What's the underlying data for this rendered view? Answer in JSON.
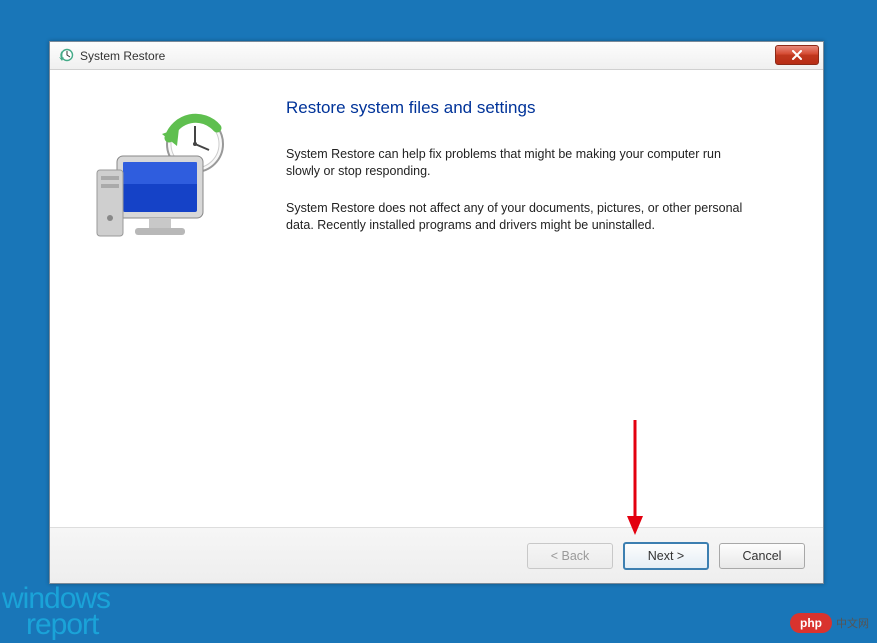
{
  "window": {
    "title": "System Restore"
  },
  "content": {
    "heading": "Restore system files and settings",
    "paragraph1": "System Restore can help fix problems that might be making your computer run slowly or stop responding.",
    "paragraph2": "System Restore does not affect any of your documents, pictures, or other personal data. Recently installed programs and drivers might be uninstalled."
  },
  "buttons": {
    "back": "< Back",
    "next": "Next >",
    "cancel": "Cancel"
  },
  "watermarks": {
    "wr_line1": "windows",
    "wr_line2": "report",
    "php_badge": "php",
    "php_text": "中文网"
  }
}
